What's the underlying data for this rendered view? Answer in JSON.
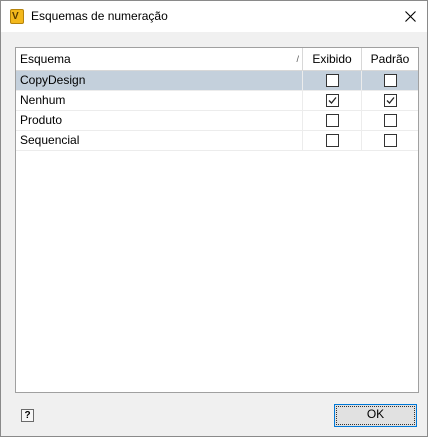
{
  "window": {
    "title": "Esquemas de numeração",
    "app_icon": "vault-app-icon"
  },
  "table": {
    "columns": {
      "name": "Esquema",
      "displayed": "Exibido",
      "default": "Padrão"
    },
    "sort_indicator": "/",
    "rows": [
      {
        "name": "CopyDesign",
        "displayed": false,
        "default": false,
        "selected": true
      },
      {
        "name": "Nenhum",
        "displayed": true,
        "default": true,
        "selected": false
      },
      {
        "name": "Produto",
        "displayed": false,
        "default": false,
        "selected": false
      },
      {
        "name": "Sequencial",
        "displayed": false,
        "default": false,
        "selected": false
      }
    ]
  },
  "footer": {
    "help_label": "?",
    "ok_label": "OK"
  },
  "colors": {
    "selection": "#c4d0dc",
    "focus_border": "#0078d7"
  }
}
